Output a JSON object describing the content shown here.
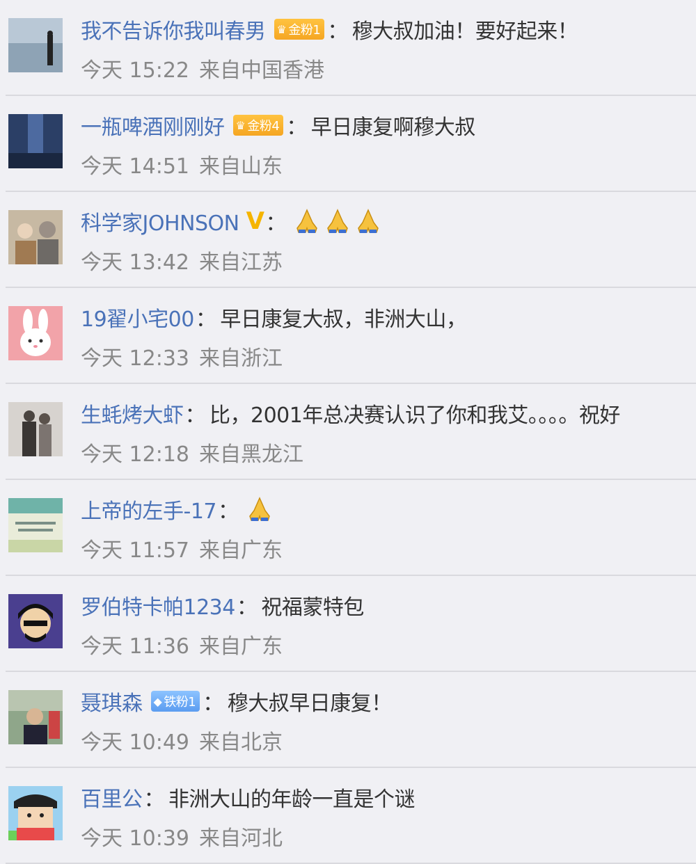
{
  "comments": [
    {
      "user": "我不告诉你我叫春男",
      "badge": {
        "type": "gold",
        "label": "金粉1",
        "icon": "crown-icon"
      },
      "text": "穆大叔加油！要好起来！",
      "time": "今天 15:22",
      "location": "来自中国香港"
    },
    {
      "user": "一瓶啤酒刚刚好",
      "badge": {
        "type": "gold",
        "label": "金粉4",
        "icon": "crown-icon"
      },
      "text": "早日康复啊穆大叔",
      "time": "今天 14:51",
      "location": "来自山东"
    },
    {
      "user": "科学家JOHNSON",
      "verified": "V",
      "text": "",
      "emoji": [
        "praying-hands-icon",
        "praying-hands-icon",
        "praying-hands-icon"
      ],
      "time": "今天 13:42",
      "location": "来自江苏"
    },
    {
      "user": "19翟小宅00",
      "text": "早日康复大叔，非洲大山，",
      "time": "今天 12:33",
      "location": "来自浙江"
    },
    {
      "user": "生蚝烤大虾",
      "text": "比，2001年总决赛认识了你和我艾。。。。祝好",
      "time": "今天 12:18",
      "location": "来自黑龙江"
    },
    {
      "user": "上帝的左手-17",
      "text": "",
      "emoji": [
        "praying-hands-icon"
      ],
      "time": "今天 11:57",
      "location": "来自广东"
    },
    {
      "user": "罗伯特卡帕1234",
      "text": "祝福蒙特包",
      "time": "今天 11:36",
      "location": "来自广东"
    },
    {
      "user": "聂琪森",
      "badge": {
        "type": "iron",
        "label": "铁粉1",
        "icon": "diamond-icon"
      },
      "text": "穆大叔早日康复！",
      "time": "今天 10:49",
      "location": "来自北京"
    },
    {
      "user": "百里公",
      "text": "非洲大山的年龄一直是个谜",
      "time": "今天 10:39",
      "location": "来自河北"
    }
  ],
  "colon": "：",
  "colors": {
    "username": "#4a72b8",
    "gold_badge": "#f5a623",
    "iron_badge": "#5b9cf0",
    "verified": "#f5b400",
    "divider": "#d9d9de"
  }
}
